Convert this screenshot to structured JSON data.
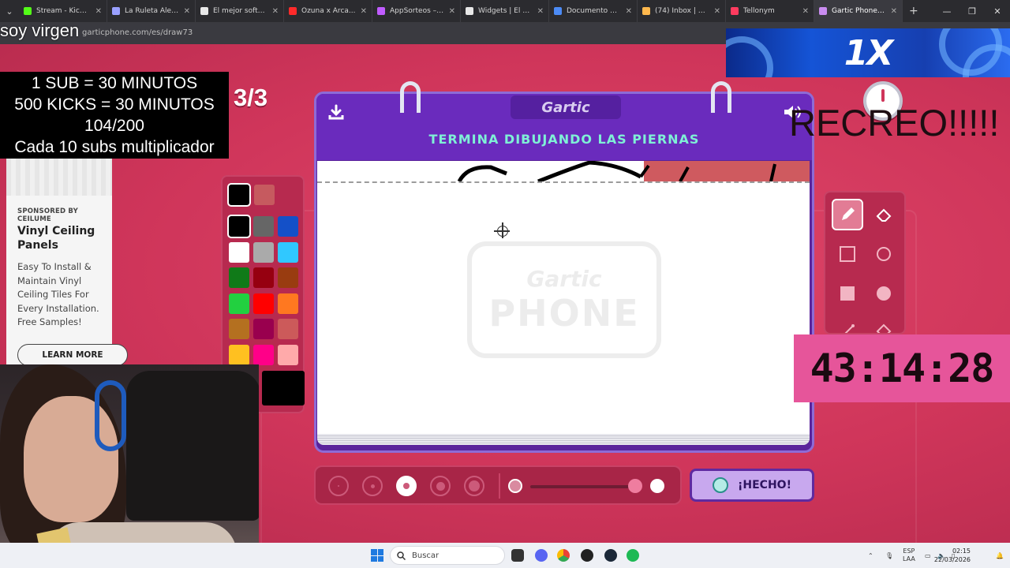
{
  "browser": {
    "tabs": [
      {
        "label": "Stream - Kick Da...",
        "color": "#53fc18"
      },
      {
        "label": "La Ruleta Aleator...",
        "color": "#9aa0ff"
      },
      {
        "label": "El mejor software...",
        "color": "#e8e8e8"
      },
      {
        "label": "Ozuna x Arca...",
        "color": "#ff2a2a"
      },
      {
        "label": "AppSorteos – La F...",
        "color": "#c05cff"
      },
      {
        "label": "Widgets | El mejo...",
        "color": "#e8e8e8"
      },
      {
        "label": "Documento sin tít...",
        "color": "#4c8bf5"
      },
      {
        "label": "(74) Inbox | Donor...",
        "color": "#ffb84d"
      },
      {
        "label": "Tellonym",
        "color": "#ff3b5f"
      },
      {
        "label": "Gartic Phone - Te...",
        "color": "#c98cf0"
      }
    ],
    "url": "garticphone.com/es/draw73"
  },
  "overlay": {
    "username": "soy virgen",
    "subs_lines": [
      "1 SUB      = 30 MINUTOS",
      "500 KICKS = 30 MINUTOS",
      "104/200",
      "Cada 10 subs multiplicador"
    ],
    "round": "3/3",
    "banner": "1X",
    "recreo": "RECREO!!!!!",
    "timer": "43:14:28"
  },
  "ad": {
    "sponsor": "SPONSORED BY CEILUME",
    "title": "Vinyl Ceiling Panels",
    "body": "Easy To Install & Maintain Vinyl Ceiling Tiles For Every Installation. Free Samples!",
    "cta": "LEARN MORE"
  },
  "game": {
    "logo": "Gartic",
    "instruction": "TERMINA DIBUJANDO LAS PIERNAS",
    "watermark_top": "Gartic",
    "watermark_bottom": "PHONE",
    "done_label": "¡HECHO!",
    "recent_colors": [
      "#000000",
      "#c65a5f"
    ],
    "palette": [
      "#000000",
      "#666666",
      "#1450c8",
      "#ffffff",
      "#aaaaaa",
      "#30c8ff",
      "#107a18",
      "#960010",
      "#993c10",
      "#22d040",
      "#ff0000",
      "#ff7820",
      "#b47020",
      "#99004e",
      "#cc5a5a",
      "#ffc020",
      "#ff0088",
      "#ffaaaa"
    ],
    "current_color": "#000000",
    "tools": [
      "pencil-icon",
      "eraser-icon",
      "rectangle-outline-icon",
      "circle-outline-icon",
      "rectangle-fill-icon",
      "circle-fill-icon",
      "line-icon",
      "fill-bucket-icon"
    ],
    "selected_tool": "pencil-icon",
    "brush_sizes": 5,
    "selected_size": 3
  },
  "taskbar": {
    "search_placeholder": "Buscar",
    "lang_top": "ESP",
    "lang_bottom": "LAA",
    "time": "02:15",
    "date": "22/03/2026"
  }
}
